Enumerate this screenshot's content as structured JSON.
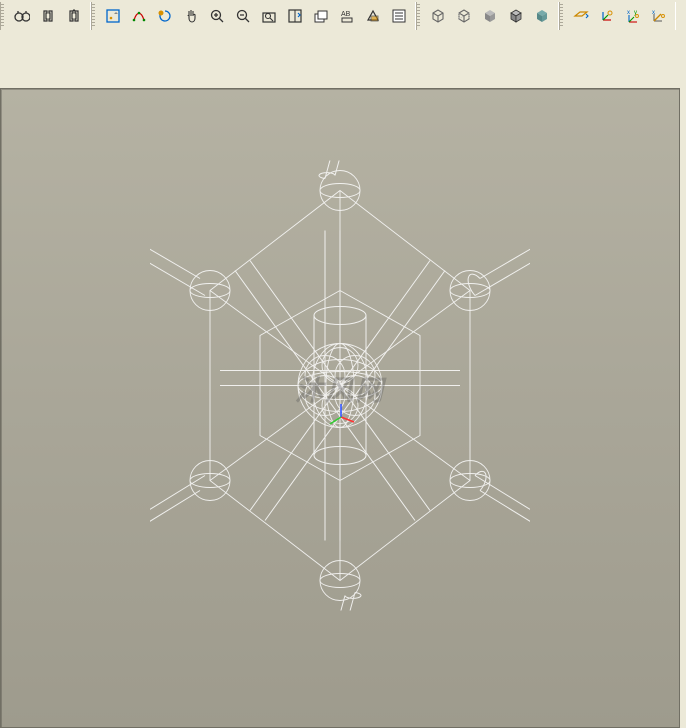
{
  "toolbar": {
    "group1": [
      {
        "name": "binoculars-icon"
      },
      {
        "name": "bracket-icon"
      },
      {
        "name": "bracket-up-icon"
      }
    ],
    "group2": [
      {
        "name": "fit-view-icon"
      },
      {
        "name": "curve-icon"
      },
      {
        "name": "spin-icon"
      },
      {
        "name": "pan-icon"
      },
      {
        "name": "zoom-in-icon"
      },
      {
        "name": "zoom-out-icon"
      },
      {
        "name": "zoom-window-icon"
      },
      {
        "name": "zoom-layer-icon"
      },
      {
        "name": "layers-icon"
      },
      {
        "name": "label-ab-icon"
      },
      {
        "name": "section-icon"
      },
      {
        "name": "list-icon"
      }
    ],
    "group3": [
      {
        "name": "cube-wire-icon"
      },
      {
        "name": "cube-hidden-icon"
      },
      {
        "name": "cube-shade-icon"
      },
      {
        "name": "cube-edge-icon"
      },
      {
        "name": "cube-solid-icon"
      }
    ],
    "group4": [
      {
        "name": "plane-xy-icon"
      },
      {
        "name": "axes-small-icon"
      },
      {
        "name": "axes-xyz-icon"
      },
      {
        "name": "axes-diag-icon"
      }
    ]
  },
  "viewport": {
    "watermark": "沐风网",
    "axis_colors": {
      "x": "#ff3333",
      "y": "#33cc33",
      "z": "#3355ff"
    }
  }
}
